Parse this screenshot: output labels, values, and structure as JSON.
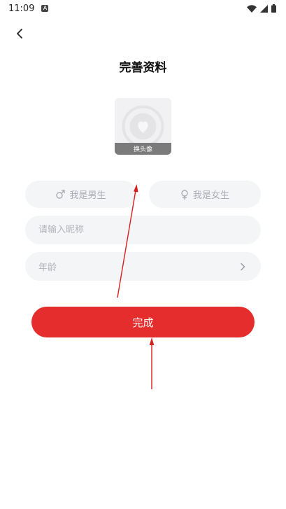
{
  "status_bar": {
    "time": "11:09",
    "app_icon_letter": "A"
  },
  "header": {
    "title": "完善资料"
  },
  "avatar": {
    "change_label": "换头像"
  },
  "gender": {
    "male_label": "我是男生",
    "female_label": "我是女生"
  },
  "form": {
    "nickname_placeholder": "请输入昵称",
    "age_placeholder": "年龄"
  },
  "actions": {
    "done_label": "完成"
  },
  "colors": {
    "accent": "#e52d2d",
    "field_bg": "#f4f5f7",
    "placeholder": "#b1b4ba"
  }
}
